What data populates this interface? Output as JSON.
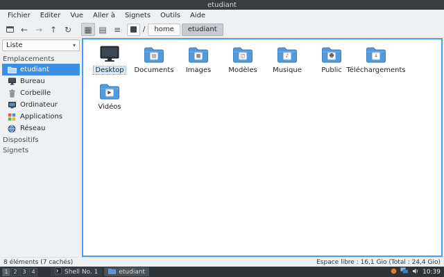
{
  "window": {
    "title": "etudiant"
  },
  "menubar": {
    "items": [
      "Fichier",
      "Editer",
      "Vue",
      "Aller à",
      "Signets",
      "Outils",
      "Aide"
    ]
  },
  "toolbar": {
    "back_icon": "←",
    "forward_icon": "→",
    "up_icon": "↑",
    "refresh_icon": "↻",
    "icon_view_icon": "▦",
    "compact_view_icon": "▤",
    "list_view_icon": "≡",
    "path": {
      "root": "/",
      "segments": [
        "home",
        "etudiant"
      ]
    }
  },
  "sidebar": {
    "view_mode": "Liste",
    "dropdown_icon": "▾",
    "sections": [
      {
        "header": "Emplacements"
      },
      {
        "header": "Dispositifs"
      },
      {
        "header": "Signets"
      }
    ],
    "places": [
      "etudiant",
      "Bureau",
      "Corbeille",
      "Ordinateur",
      "Applications",
      "Réseau"
    ]
  },
  "files": [
    {
      "label": "Desktop"
    },
    {
      "label": "Documents",
      "emblem": "▤"
    },
    {
      "label": "Images",
      "emblem": "▦"
    },
    {
      "label": "Modèles",
      "emblem": "◫"
    },
    {
      "label": "Musique",
      "emblem": "♪"
    },
    {
      "label": "Public",
      "emblem": "☻"
    },
    {
      "label": "Téléchargements",
      "emblem": "↓"
    },
    {
      "label": "Vidéos",
      "emblem": "▶"
    }
  ],
  "statusbar": {
    "items_text": "8 éléments (7 cachés)",
    "free_space_text": "Espace libre : 16,1 Gio (Total : 24,4 Gio)"
  },
  "taskbar": {
    "workspaces": [
      "1",
      "2",
      "3",
      "4"
    ],
    "tasks": [
      {
        "label": "Shell No. 1"
      },
      {
        "label": "etudiant"
      }
    ],
    "clock": "10:39"
  },
  "colors": {
    "accent": "#4a9ded",
    "selection": "#3d8ee0",
    "folder": "#4f9bdc",
    "titlebar_bg": "#3a3d40",
    "taskbar_bg": "#2e3338"
  }
}
